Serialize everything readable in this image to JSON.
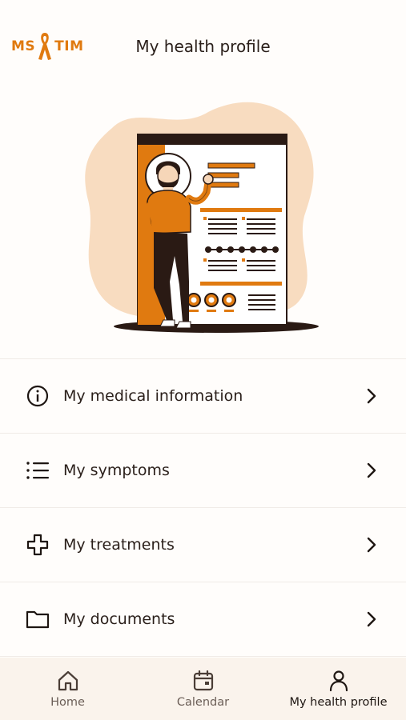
{
  "header": {
    "logo_left": "MS",
    "logo_right": "TIM",
    "title": "My health profile"
  },
  "colors": {
    "accent": "#e07a10",
    "peach": "#f8dcc0",
    "dark": "#2a1f1a",
    "nav_bg": "#faf3ec"
  },
  "menu": {
    "items": [
      {
        "label": "My medical information",
        "icon": "info-icon"
      },
      {
        "label": "My symptoms",
        "icon": "list-icon"
      },
      {
        "label": "My treatments",
        "icon": "plus-cross-icon"
      },
      {
        "label": "My documents",
        "icon": "folder-icon"
      }
    ]
  },
  "bottom_nav": {
    "items": [
      {
        "label": "Home",
        "icon": "home-icon",
        "active": false
      },
      {
        "label": "Calendar",
        "icon": "calendar-icon",
        "active": false
      },
      {
        "label": "My health profile",
        "icon": "person-icon",
        "active": true
      }
    ]
  }
}
